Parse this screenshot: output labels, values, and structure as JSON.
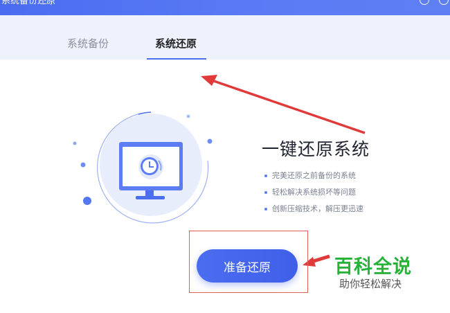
{
  "window": {
    "title": "系统备份还原",
    "icons": [
      "shield-icon",
      "settings-icon"
    ]
  },
  "tabs": [
    {
      "label": "系统备份",
      "active": false
    },
    {
      "label": "系统还原",
      "active": true
    }
  ],
  "main": {
    "heading": "一键还原系统",
    "features": [
      "完美还原之前备份的系统",
      "轻松解决系统损坏等问题",
      "创新压缩技术，解压更迅速"
    ],
    "button_label": "准备还原",
    "illustration": "monitor-clock-icon"
  },
  "watermark": {
    "title": "百科全说",
    "subtitle": "助你轻松解决"
  },
  "colors": {
    "accent": "#4b6ef0",
    "tab_bar_bg": "#eef2fd",
    "annotation_red": "#e03a3a",
    "brand_green": "#27b23a"
  }
}
